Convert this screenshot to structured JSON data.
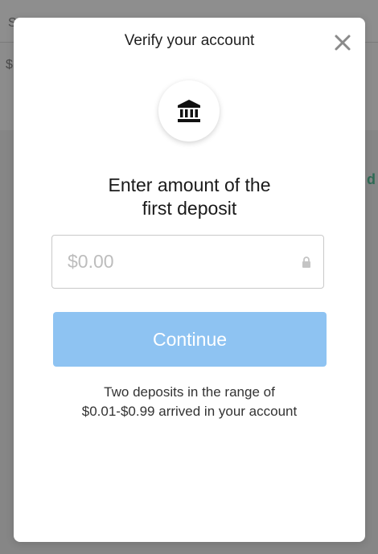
{
  "background": {
    "top_left_text": "S",
    "second_text": "$",
    "right_text": "d"
  },
  "modal": {
    "title": "Verify your account",
    "close_icon": "close-icon",
    "bank_icon": "bank-icon",
    "heading_line1": "Enter amount of the",
    "heading_line2": "first deposit",
    "amount_input": {
      "value": "",
      "placeholder": "$0.00"
    },
    "lock_icon": "lock-icon",
    "continue_label": "Continue",
    "note_line1": "Two deposits in the range of",
    "note_line2": "$0.01-$0.99 arrived in your account"
  },
  "colors": {
    "button": "#8ec3f2",
    "overlay": "#8c8c8c"
  }
}
